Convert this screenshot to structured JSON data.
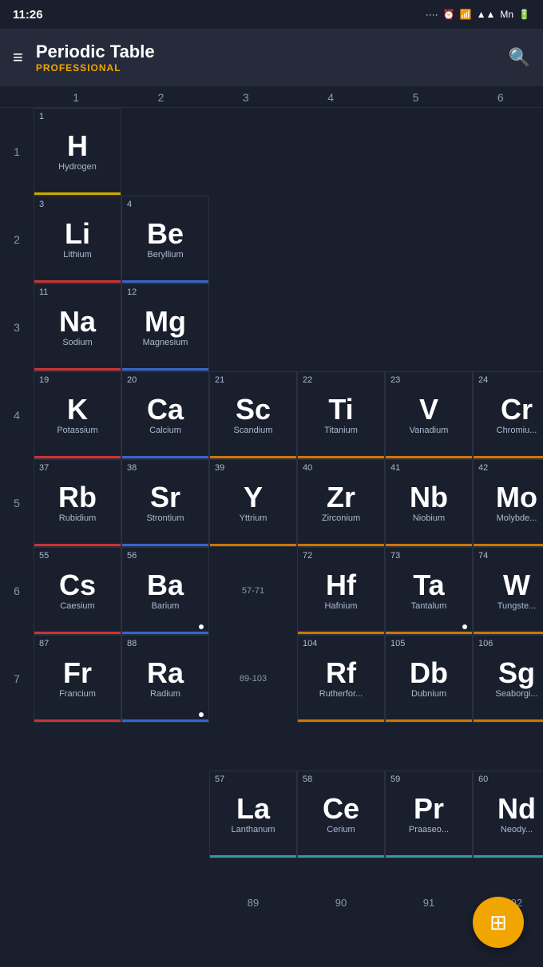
{
  "statusBar": {
    "time": "11:26",
    "icons": ".... ⏰ 📶 ▲ 🔋"
  },
  "header": {
    "title": "Periodic Table",
    "subtitle": "PROFESSIONAL",
    "menuLabel": "≡",
    "searchLabel": "🔍"
  },
  "columns": [
    "1",
    "2",
    "3",
    "4",
    "5",
    "6"
  ],
  "rows": [
    {
      "rowNum": "",
      "elements": []
    }
  ],
  "elements": {
    "H": {
      "num": "1",
      "symbol": "H",
      "name": "Hydrogen",
      "color": "yellow"
    },
    "Li": {
      "num": "3",
      "symbol": "Li",
      "name": "Lithium",
      "color": "red"
    },
    "Be": {
      "num": "4",
      "symbol": "Be",
      "name": "Beryllium",
      "color": "blue"
    },
    "Na": {
      "num": "11",
      "symbol": "Na",
      "name": "Sodium",
      "color": "red"
    },
    "Mg": {
      "num": "12",
      "symbol": "Mg",
      "name": "Magnesium",
      "color": "blue"
    },
    "K": {
      "num": "19",
      "symbol": "K",
      "name": "Potassium",
      "color": "red"
    },
    "Ca": {
      "num": "20",
      "symbol": "Ca",
      "name": "Calcium",
      "color": "blue"
    },
    "Sc": {
      "num": "21",
      "symbol": "Sc",
      "name": "Scandium",
      "color": "orange"
    },
    "Ti": {
      "num": "22",
      "symbol": "Ti",
      "name": "Titanium",
      "color": "orange"
    },
    "V": {
      "num": "23",
      "symbol": "V",
      "name": "Vanadium",
      "color": "orange"
    },
    "Cr": {
      "num": "24",
      "symbol": "Cr",
      "name": "Chromium",
      "color": "orange"
    },
    "Rb": {
      "num": "37",
      "symbol": "Rb",
      "name": "Rubidium",
      "color": "red"
    },
    "Sr": {
      "num": "38",
      "symbol": "Sr",
      "name": "Strontium",
      "color": "blue"
    },
    "Y": {
      "num": "39",
      "symbol": "Y",
      "name": "Yttrium",
      "color": "orange"
    },
    "Zr": {
      "num": "40",
      "symbol": "Zr",
      "name": "Zirconium",
      "color": "orange"
    },
    "Nb": {
      "num": "41",
      "symbol": "Nb",
      "name": "Niobium",
      "color": "orange"
    },
    "Mo": {
      "num": "42",
      "symbol": "Mo",
      "name": "Molybde...",
      "color": "orange"
    },
    "Cs": {
      "num": "55",
      "symbol": "Cs",
      "name": "Caesium",
      "color": "red"
    },
    "Ba": {
      "num": "56",
      "symbol": "Ba",
      "name": "Barium",
      "color": "blue"
    },
    "Hf": {
      "num": "72",
      "symbol": "Hf",
      "name": "Hafnium",
      "color": "orange"
    },
    "Ta": {
      "num": "73",
      "symbol": "Ta",
      "name": "Tantalum",
      "color": "orange"
    },
    "W": {
      "num": "74",
      "symbol": "W",
      "name": "Tungste...",
      "color": "orange"
    },
    "Fr": {
      "num": "87",
      "symbol": "Fr",
      "name": "Francium",
      "color": "red"
    },
    "Ra": {
      "num": "88",
      "symbol": "Ra",
      "name": "Radium",
      "color": "blue"
    },
    "Rf": {
      "num": "104",
      "symbol": "Rf",
      "name": "Rutherfor...",
      "color": "orange"
    },
    "Db": {
      "num": "105",
      "symbol": "Db",
      "name": "Dubnium",
      "color": "orange"
    },
    "Sg": {
      "num": "106",
      "symbol": "Sg",
      "name": "Seaborgi...",
      "color": "orange"
    },
    "La": {
      "num": "57",
      "symbol": "La",
      "name": "Lanthanum",
      "color": "teal"
    },
    "Ce": {
      "num": "58",
      "symbol": "Ce",
      "name": "Cerium",
      "color": "teal"
    },
    "Pr": {
      "num": "59",
      "symbol": "Pr",
      "name": "Praase...",
      "color": "teal"
    }
  },
  "fab": {
    "icon": "⊞",
    "label": "grid-view"
  },
  "colHeadersLabel": "column-headers",
  "rangeLabel": {
    "row6col3": "57-71",
    "row7col3": "89-103"
  }
}
